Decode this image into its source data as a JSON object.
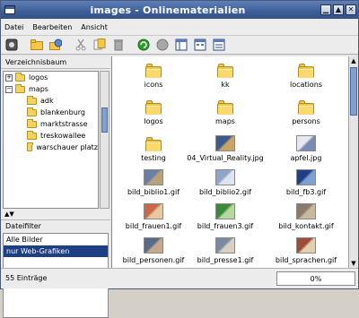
{
  "window": {
    "title": "images - Onlinematerialien"
  },
  "menu": [
    {
      "label": "Datei"
    },
    {
      "label": "Bearbeiten"
    },
    {
      "label": "Ansicht"
    }
  ],
  "toolbar": [
    {
      "name": "info-icon"
    },
    {
      "name": "open-folder-icon"
    },
    {
      "name": "globe-folder-icon"
    },
    {
      "name": "cut-icon"
    },
    {
      "name": "copy-icon"
    },
    {
      "name": "trash-icon"
    },
    {
      "name": "reload-icon"
    },
    {
      "name": "stop-icon"
    },
    {
      "name": "view-columns-icon"
    },
    {
      "name": "view-icons-icon"
    },
    {
      "name": "view-list-icon"
    }
  ],
  "tree": {
    "header": "Verzeichnisbaum",
    "items": [
      {
        "label": "logos",
        "expander": "+",
        "indent": 0
      },
      {
        "label": "maps",
        "expander": "−",
        "indent": 0
      },
      {
        "label": "adk",
        "expander": "",
        "indent": 1
      },
      {
        "label": "blankenburg",
        "expander": "",
        "indent": 1
      },
      {
        "label": "marktstrasse",
        "expander": "",
        "indent": 1
      },
      {
        "label": "treskowallee",
        "expander": "",
        "indent": 1
      },
      {
        "label": "warschauer platz",
        "expander": "",
        "indent": 1
      }
    ]
  },
  "filter": {
    "header": "Dateifilter",
    "items": [
      {
        "label": "Alle Bilder",
        "selected": false
      },
      {
        "label": "nur Web-Grafiken",
        "selected": true
      }
    ]
  },
  "files": [
    {
      "label": "icons",
      "kind": "folder"
    },
    {
      "label": "kk",
      "kind": "folder"
    },
    {
      "label": "locations",
      "kind": "folder"
    },
    {
      "label": "logos",
      "kind": "folder"
    },
    {
      "label": "maps",
      "kind": "folder"
    },
    {
      "label": "persons",
      "kind": "folder"
    },
    {
      "label": "testing",
      "kind": "folder"
    },
    {
      "label": "04_Virtual_Reality.jpg",
      "kind": "image",
      "colors": [
        "#3b5b8a",
        "#c9a46a"
      ]
    },
    {
      "label": "apfel.jpg",
      "kind": "image",
      "colors": [
        "#e8e8f0",
        "#7a8ab0"
      ]
    },
    {
      "label": "bild_biblio1.gif",
      "kind": "image",
      "colors": [
        "#6a7fa8",
        "#b8a078"
      ]
    },
    {
      "label": "bild_biblio2.gif",
      "kind": "image",
      "colors": [
        "#8fa6c8",
        "#dde6f0"
      ]
    },
    {
      "label": "bild_fb3.gif",
      "kind": "image",
      "colors": [
        "#1f3f85",
        "#7fa0d0"
      ]
    },
    {
      "label": "bild_frauen1.gif",
      "kind": "image",
      "colors": [
        "#c86a4a",
        "#e8c8a0"
      ]
    },
    {
      "label": "bild_frauen3.gif",
      "kind": "image",
      "colors": [
        "#3a8a3a",
        "#b8d8a0"
      ]
    },
    {
      "label": "bild_kontakt.gif",
      "kind": "image",
      "colors": [
        "#8a7a6a",
        "#c8b8a0"
      ]
    },
    {
      "label": "bild_personen.gif",
      "kind": "image",
      "colors": [
        "#5a6a8a",
        "#c8a88a"
      ]
    },
    {
      "label": "bild_presse1.gif",
      "kind": "image",
      "colors": [
        "#7a8aa0",
        "#d8d0c0"
      ]
    },
    {
      "label": "bild_sprachen.gif",
      "kind": "image",
      "colors": [
        "#a04a3a",
        "#e0d0b0"
      ]
    }
  ],
  "status": {
    "count": "55 Einträge",
    "progress": "0%"
  }
}
